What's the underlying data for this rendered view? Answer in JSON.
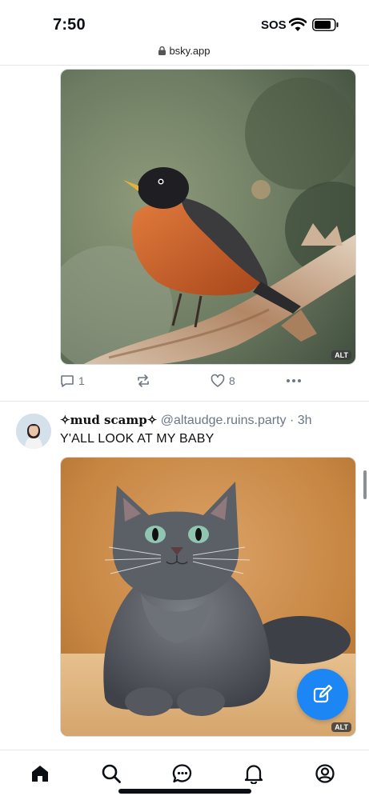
{
  "status_bar": {
    "time": "7:50",
    "sos": "SOS"
  },
  "browser": {
    "url": "bsky.app"
  },
  "posts": [
    {
      "image_alt_badge": "ALT",
      "image_subject": "robin on branch",
      "replies": "1",
      "reposts": "",
      "likes": "8"
    },
    {
      "display_name": "✧mud scamp✧",
      "handle": "@altaudge.ruins.party",
      "time": "· 3h",
      "text": "Y'ALL LOOK AT MY BABY",
      "image_alt_badge": "ALT",
      "image_subject": "grey long-haired cat"
    }
  ],
  "nav": [
    "home-icon",
    "search-icon",
    "chat-icon",
    "bell-icon",
    "profile-icon"
  ],
  "colors": {
    "accent": "#1d86f5",
    "muted": "#6b7785"
  }
}
